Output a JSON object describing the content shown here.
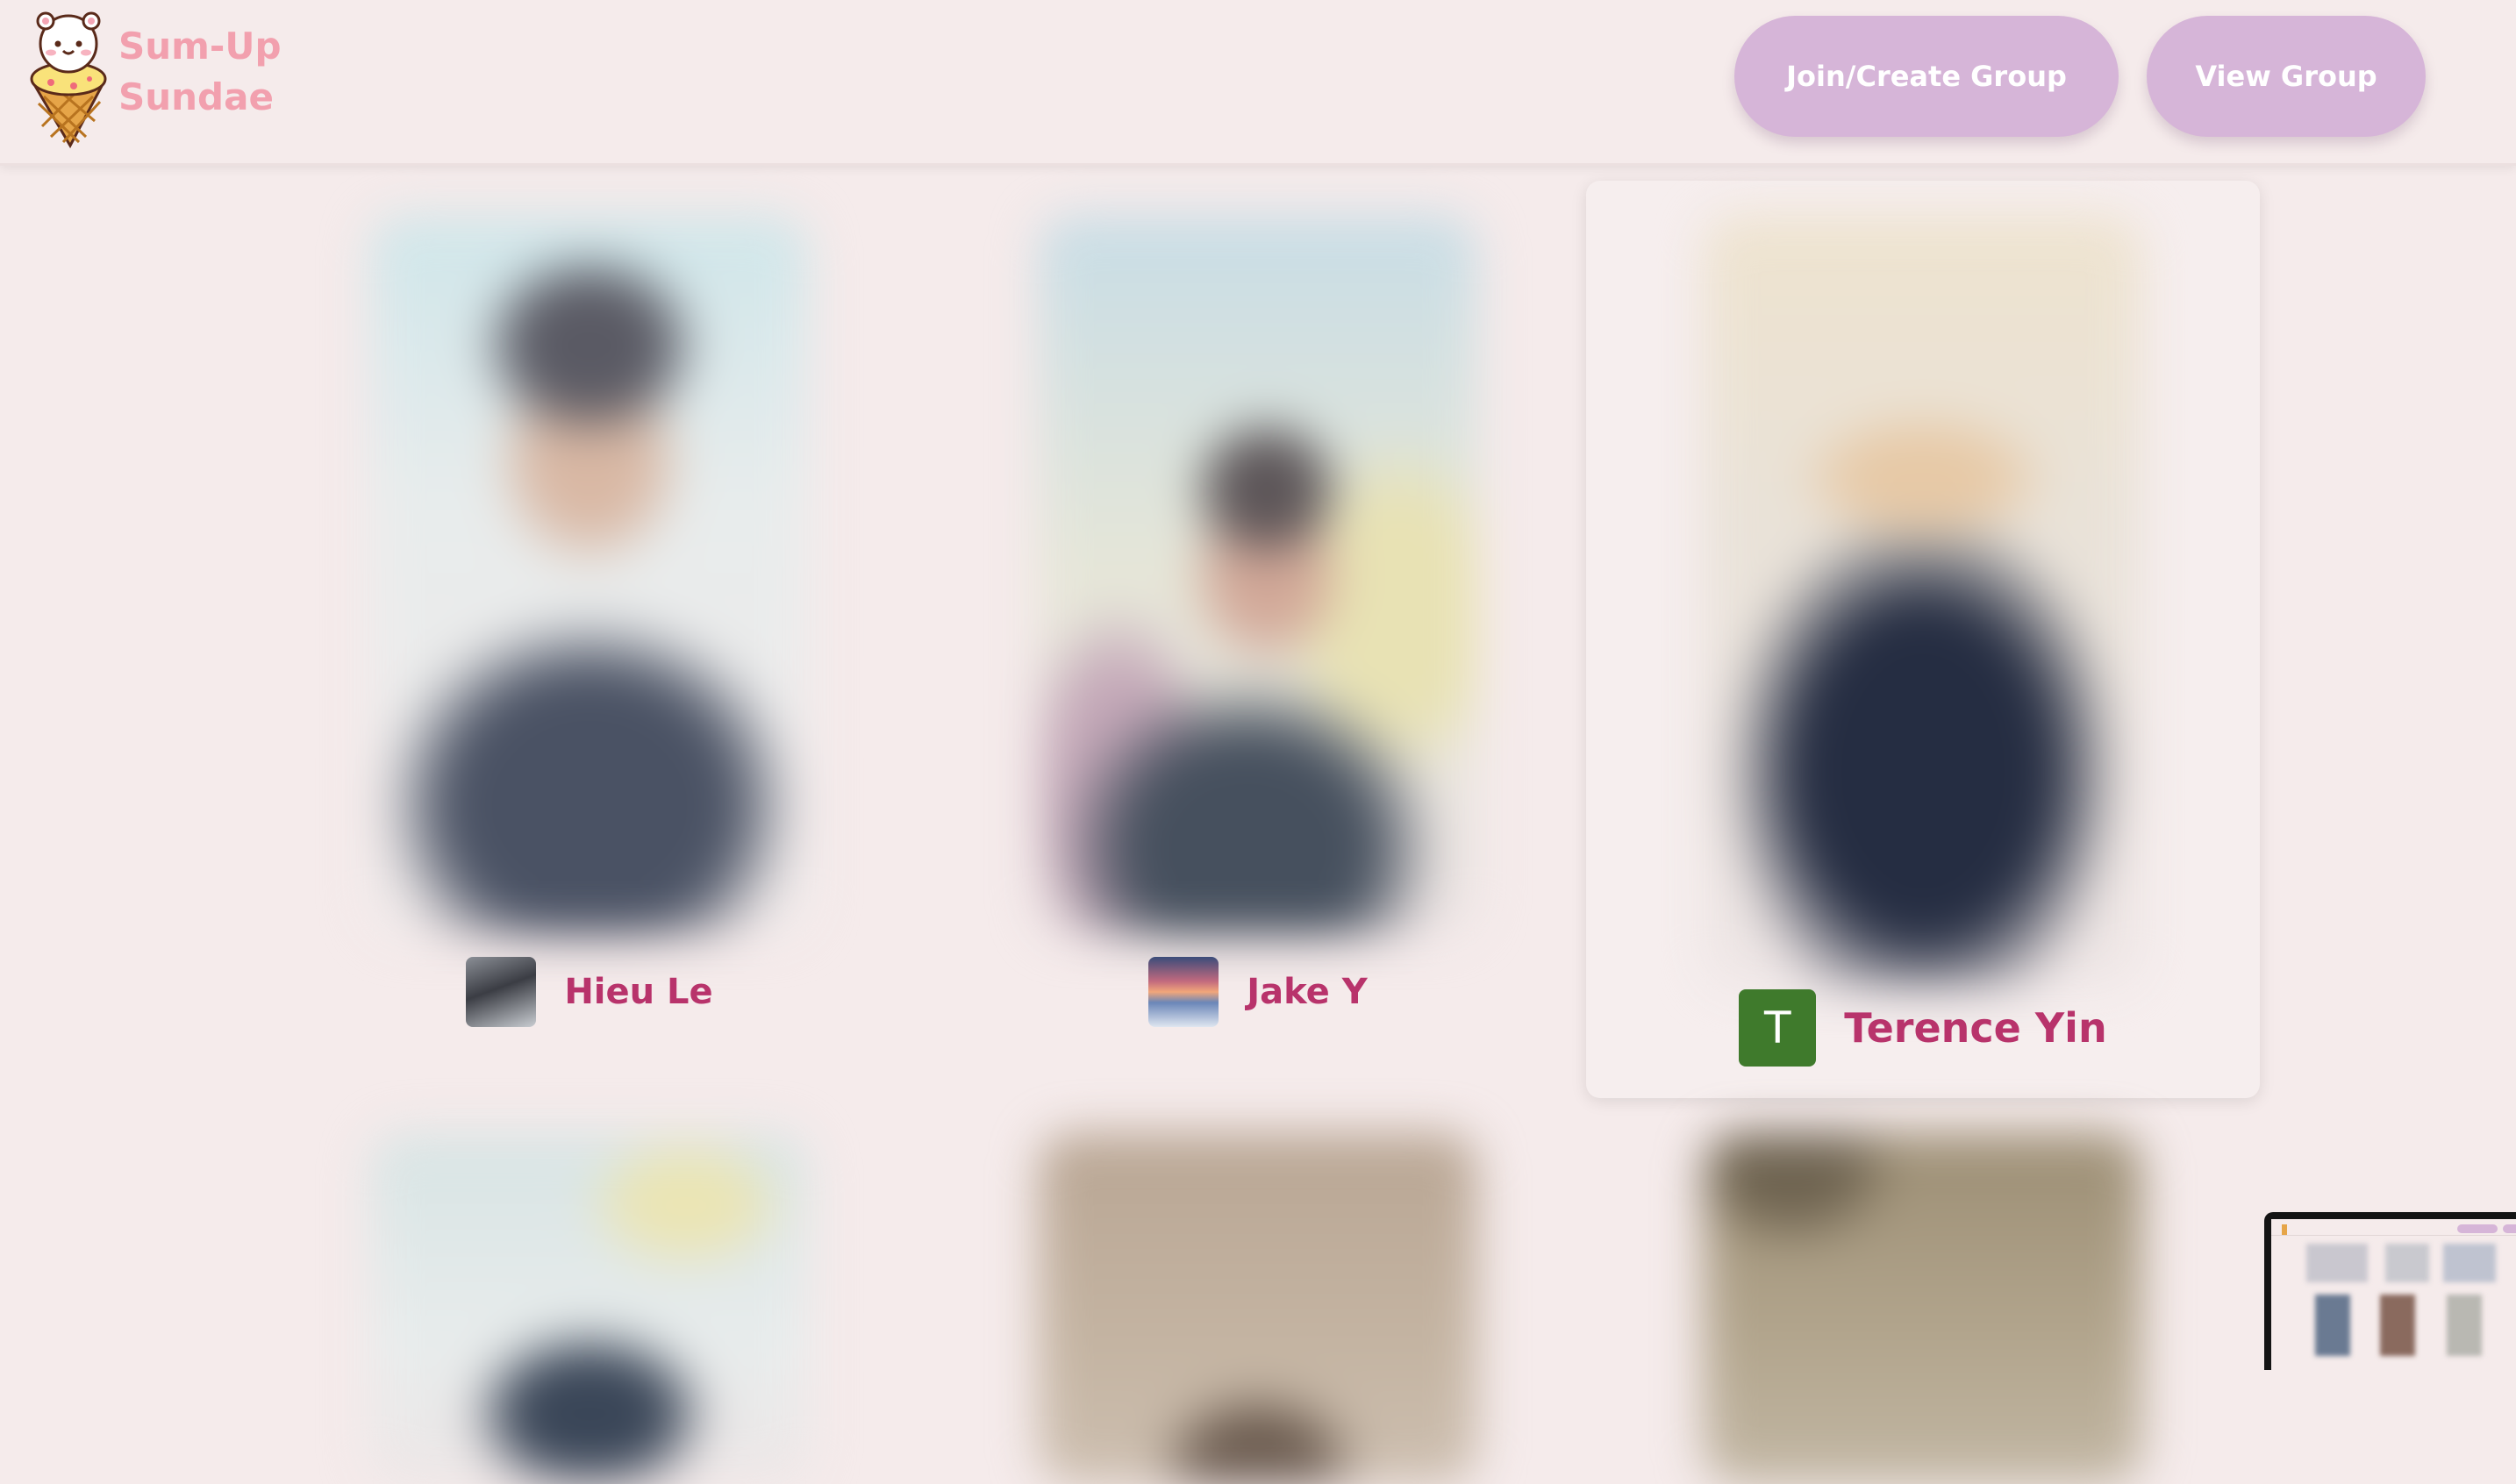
{
  "header": {
    "brand_line1": "Sum-Up",
    "brand_line2": "Sundae",
    "join_label": "Join/Create Group",
    "view_label": "View Group"
  },
  "members": [
    {
      "name": "Hieu Le"
    },
    {
      "name": "Jake Y"
    },
    {
      "name": "Terence Yin",
      "initial": "T"
    }
  ],
  "colors": {
    "background": "#f5ebeb",
    "brand": "#f2a0ae",
    "button": "#d6b5d8",
    "member_name": "#b8336b",
    "initial_avatar": "#3f7a2c"
  }
}
